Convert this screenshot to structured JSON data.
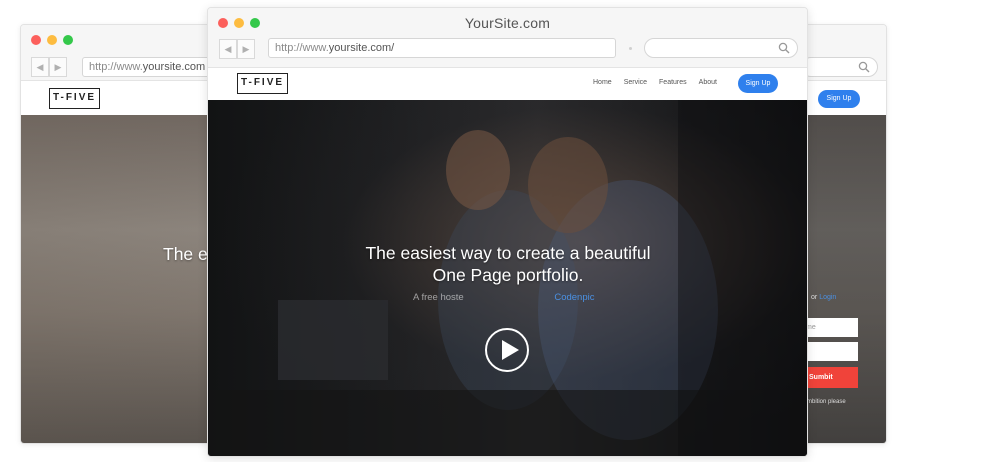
{
  "back_window": {
    "url_prefix": "http://www.",
    "url_domain": "yoursite.com",
    "logo": "T-FIVE",
    "signup": "Sign Up",
    "hero_partial": "The e",
    "or_text": "or",
    "login_text": "Login",
    "field1": "me",
    "submit_partial": "Sumbit",
    "note_partial": "mbition please"
  },
  "front_window": {
    "title": "YourSite.com",
    "url_prefix": "http://www.",
    "url_domain": "yoursite.com/",
    "logo": "T-FIVE",
    "menu": [
      "Home",
      "Service",
      "Features",
      "About"
    ],
    "signup": "Sign Up",
    "hero_line1": "The easiest way to create a beautiful",
    "hero_line2": "One Page portfolio.",
    "sub_prefix": "A free hoste",
    "sub_accent": "Codenpic"
  },
  "colors": {
    "accent": "#2f80ed",
    "submit": "#f0433a",
    "traffic_red": "#fc605c",
    "traffic_yellow": "#fdbc40",
    "traffic_green": "#34c84a"
  },
  "icons": [
    "back-arrow-icon",
    "forward-arrow-icon",
    "search-icon",
    "play-icon"
  ]
}
